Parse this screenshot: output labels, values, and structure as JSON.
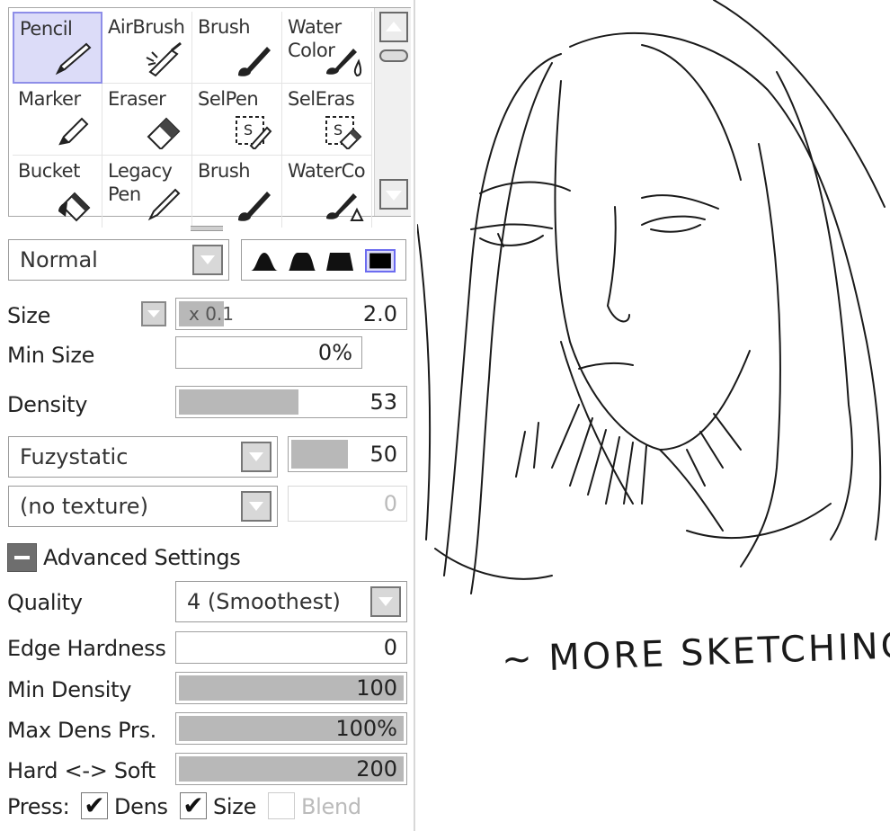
{
  "tools": [
    {
      "label": "Pencil",
      "icon": "pencil-icon",
      "selected": true
    },
    {
      "label": "AirBrush",
      "icon": "airbrush-icon"
    },
    {
      "label": "Brush",
      "icon": "brush-icon"
    },
    {
      "label": "Water\nColor",
      "icon": "watercolor-icon"
    },
    {
      "label": "Marker",
      "icon": "marker-icon"
    },
    {
      "label": "Eraser",
      "icon": "eraser-icon"
    },
    {
      "label": "SelPen",
      "icon": "selpen-icon"
    },
    {
      "label": "SelEras",
      "icon": "seleras-icon"
    },
    {
      "label": "Bucket",
      "icon": "bucket-icon"
    },
    {
      "label": "Legacy\nPen",
      "icon": "legacy-pen-icon"
    },
    {
      "label": "Brush",
      "icon": "brush-icon"
    },
    {
      "label": "WaterCo",
      "icon": "watercolor-icon"
    }
  ],
  "blend_mode": "Normal",
  "brush_shapes": [
    "soft-shape",
    "medium-shape",
    "hard-shape",
    "square-shape"
  ],
  "selected_shape": 3,
  "size": {
    "label": "Size",
    "multiplier": "x 0.1",
    "value": "2.0"
  },
  "min_size": {
    "label": "Min Size",
    "value": "0%"
  },
  "density": {
    "label": "Density",
    "value": "53",
    "fraction": 0.53
  },
  "texture_brush": {
    "name": "Fuzystatic",
    "value": "50",
    "fraction": 0.5
  },
  "texture_paper": {
    "name": "(no texture)",
    "value": "0"
  },
  "advanced": {
    "label": "Advanced Settings"
  },
  "quality": {
    "label": "Quality",
    "value": "4 (Smoothest)"
  },
  "edge_hardness": {
    "label": "Edge Hardness",
    "value": "0",
    "fraction": 0
  },
  "min_density": {
    "label": "Min Density",
    "value": "100",
    "fraction": 1.0
  },
  "max_dens_prs": {
    "label": "Max Dens Prs.",
    "value": "100%",
    "fraction": 1.0
  },
  "hard_soft": {
    "label": "Hard <-> Soft",
    "value": "200",
    "fraction": 1.0
  },
  "press": {
    "label": "Press:",
    "dens": "Dens",
    "size": "Size",
    "blend": "Blend",
    "dens_checked": true,
    "size_checked": true,
    "blend_checked": false
  },
  "canvas": {
    "caption": "~ MORE SKETCHING ~"
  },
  "colors": {
    "selection_bg": "#dcdcf8",
    "selection_border": "#8e8ee8",
    "slider_fill": "#b8b8b8"
  }
}
